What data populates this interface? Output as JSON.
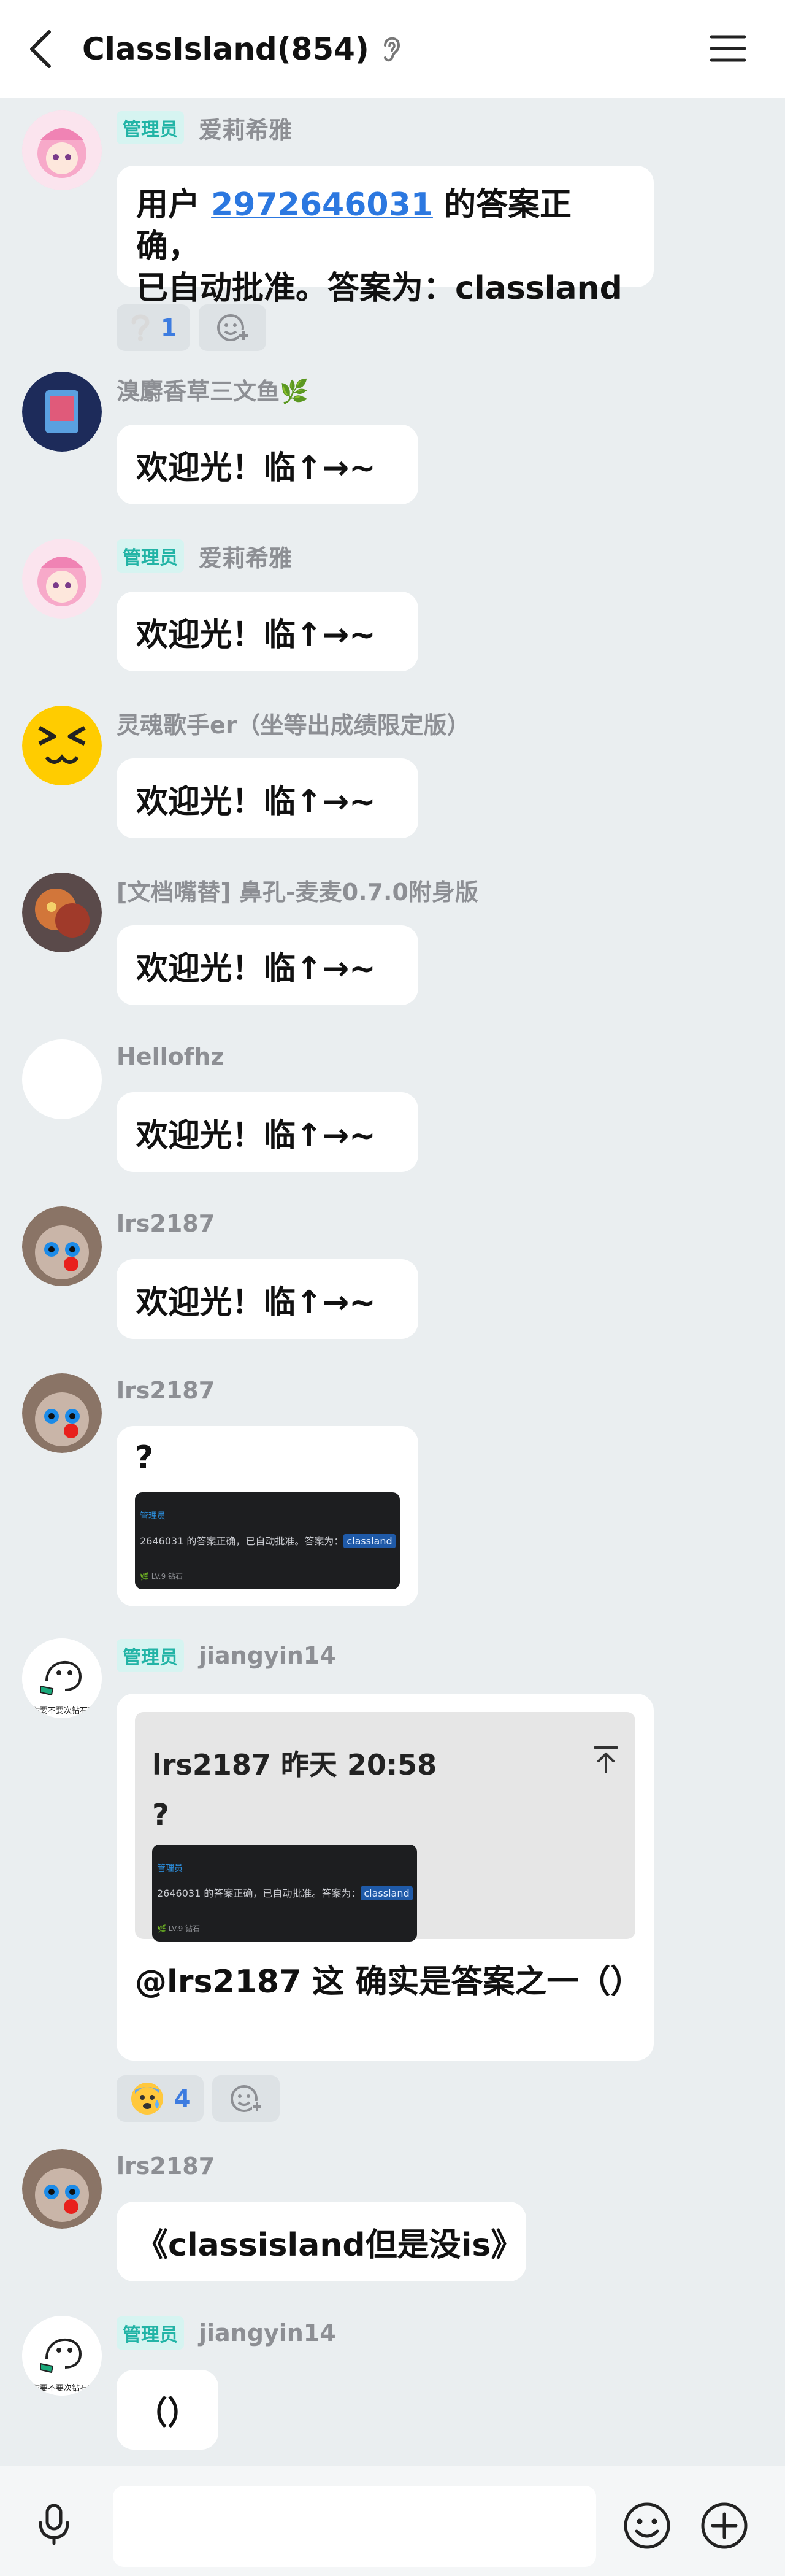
{
  "header": {
    "title": "ClassIsland(854)"
  },
  "badge_admin": "管理员",
  "messages": {
    "m1": {
      "sender": "爱莉希雅",
      "line1_pre": "用户 ",
      "user_id": "2972646031",
      "line1_post": " 的答案正确，",
      "line2": "已自动批准。答案为：classland",
      "reaction_count": "1"
    },
    "m2": {
      "sender": "溴麝香草三文鱼🌿",
      "text": "欢迎光！临↑→~"
    },
    "m3": {
      "sender": "爱莉希雅",
      "text": "欢迎光！临↑→~"
    },
    "m4": {
      "sender": "灵魂歌手er（坐等出成绩限定版）",
      "text": "欢迎光！临↑→~"
    },
    "m5": {
      "sender": "[文档嘴替] 鼻孔-麦麦0.7.0附身版",
      "text": "欢迎光！临↑→~"
    },
    "m6": {
      "sender": "Hellofhz",
      "text": "欢迎光！临↑→~"
    },
    "m7": {
      "sender": "lrs2187",
      "text": "欢迎光！临↑→~"
    },
    "m8": {
      "sender": "lrs2187",
      "text": "?",
      "shot": {
        "tag": "管理员",
        "line": "2646031 的答案正确，已自动批准。答案为：",
        "highlight": "classland",
        "footer": "🌿 LV.9 钻石"
      }
    },
    "m9": {
      "sender": "jiangyin14",
      "quote_header": "lrs2187 昨天 20:58",
      "quote_text": "?",
      "text": "@lrs2187 这 确实是答案之一（）",
      "reaction_count": "4",
      "avatar_caption": "你要不要次钻石?"
    },
    "m10": {
      "sender": "lrs2187",
      "text": "《classisland但是没is》"
    },
    "m11": {
      "sender": "jiangyin14",
      "text": "（）",
      "avatar_caption": "你要不要次钻石?"
    }
  },
  "composer": {
    "input_value": ""
  },
  "colors": {
    "background": "#eaeef0",
    "bubble": "#ffffff",
    "admin_badge": "#22b4a6",
    "link": "#2c78e0",
    "sender": "#8d8f94"
  },
  "icons": [
    "back-icon",
    "ear-icon",
    "menu-icon",
    "question-mark-icon",
    "add-reaction-icon",
    "anxious-face-icon",
    "pin-top-icon",
    "mic-icon",
    "emoji-icon",
    "plus-icon"
  ]
}
